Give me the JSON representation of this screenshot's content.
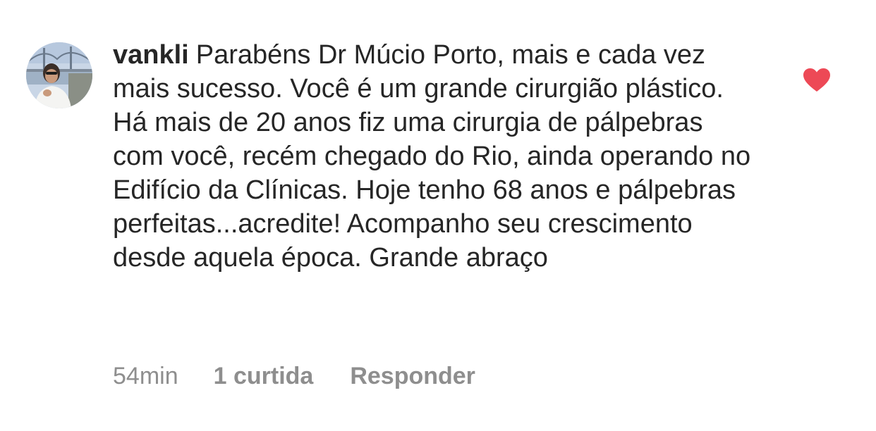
{
  "comment": {
    "username": "vankli",
    "text": "Parabéns Dr Múcio Porto, mais e cada vez mais sucesso. Você é um grande cirurgião plástico. Há mais de 20 anos fiz uma cirurgia de pálpebras com você, recém chegado do Rio, ainda operando no Edifício da Clínicas. Hoje tenho 68 anos e pálpebras perfeitas...acredite! Acompanho seu crescimento desde aquela época. Grande abraço",
    "timestamp": "54min",
    "likes_label": "1 curtida",
    "reply_label": "Responder",
    "liked": true
  },
  "icons": {
    "like": "heart-icon",
    "avatar": "user-avatar"
  },
  "colors": {
    "heart": "#ed4956",
    "username_text": "#262626",
    "meta_text": "#8e8e8e"
  }
}
